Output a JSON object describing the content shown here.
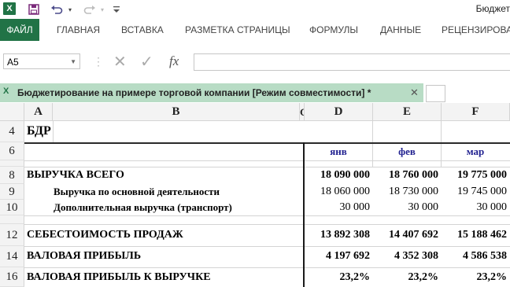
{
  "app": {
    "logo": "X",
    "title": "Бюджет"
  },
  "quick_access": {
    "save_icon": "save-icon",
    "undo_icon": "undo-icon",
    "redo_icon": "redo-icon",
    "customize_icon": "customize-icon"
  },
  "ribbon": {
    "tabs": [
      "ФАЙЛ",
      "ГЛАВНАЯ",
      "ВСТАВКА",
      "РАЗМЕТКА СТРАНИЦЫ",
      "ФОРМУЛЫ",
      "ДАННЫЕ",
      "РЕЦЕНЗИРОВА"
    ]
  },
  "formula_bar": {
    "name_box": "A5",
    "cancel": "✕",
    "enter": "✓",
    "fx": "fx",
    "formula": ""
  },
  "workbook": {
    "title": "Бюджетирование на примере торговой компании  [Режим совместимости] *",
    "close": "✕"
  },
  "columns": [
    "A",
    "B",
    "C",
    "D",
    "E",
    "F"
  ],
  "rows": {
    "r4": {
      "num": "4",
      "a": "БДР"
    },
    "r6": {
      "num": "6",
      "d": "янв",
      "e": "фев",
      "f": "мар"
    },
    "r8": {
      "num": "8",
      "a": "ВЫРУЧКА ВСЕГО",
      "d": "18 090 000",
      "e": "18 760 000",
      "f": "19 775 000"
    },
    "r9": {
      "num": "9",
      "b": "Выручка по основной деятельности",
      "d": "18 060 000",
      "e": "18 730 000",
      "f": "19 745 000"
    },
    "r10": {
      "num": "10",
      "b": "Дополнительная выручка (транспорт)",
      "d": "30 000",
      "e": "30 000",
      "f": "30 000"
    },
    "r12": {
      "num": "12",
      "a": "СЕБЕСТОИМОСТЬ ПРОДАЖ",
      "d": "13 892 308",
      "e": "14 407 692",
      "f": "15 188 462"
    },
    "r14": {
      "num": "14",
      "a": "ВАЛОВАЯ ПРИБЫЛЬ",
      "d": "4 197 692",
      "e": "4 352 308",
      "f": "4 586 538"
    },
    "r16": {
      "num": "16",
      "a": "ВАЛОВАЯ ПРИБЫЛЬ К ВЫРУЧКЕ",
      "d": "23,2%",
      "e": "23,2%",
      "f": "23,2%"
    }
  },
  "colors": {
    "excel_green": "#217346",
    "tab_green": "#b8dcc5",
    "month_blue": "#1f1f8f"
  }
}
